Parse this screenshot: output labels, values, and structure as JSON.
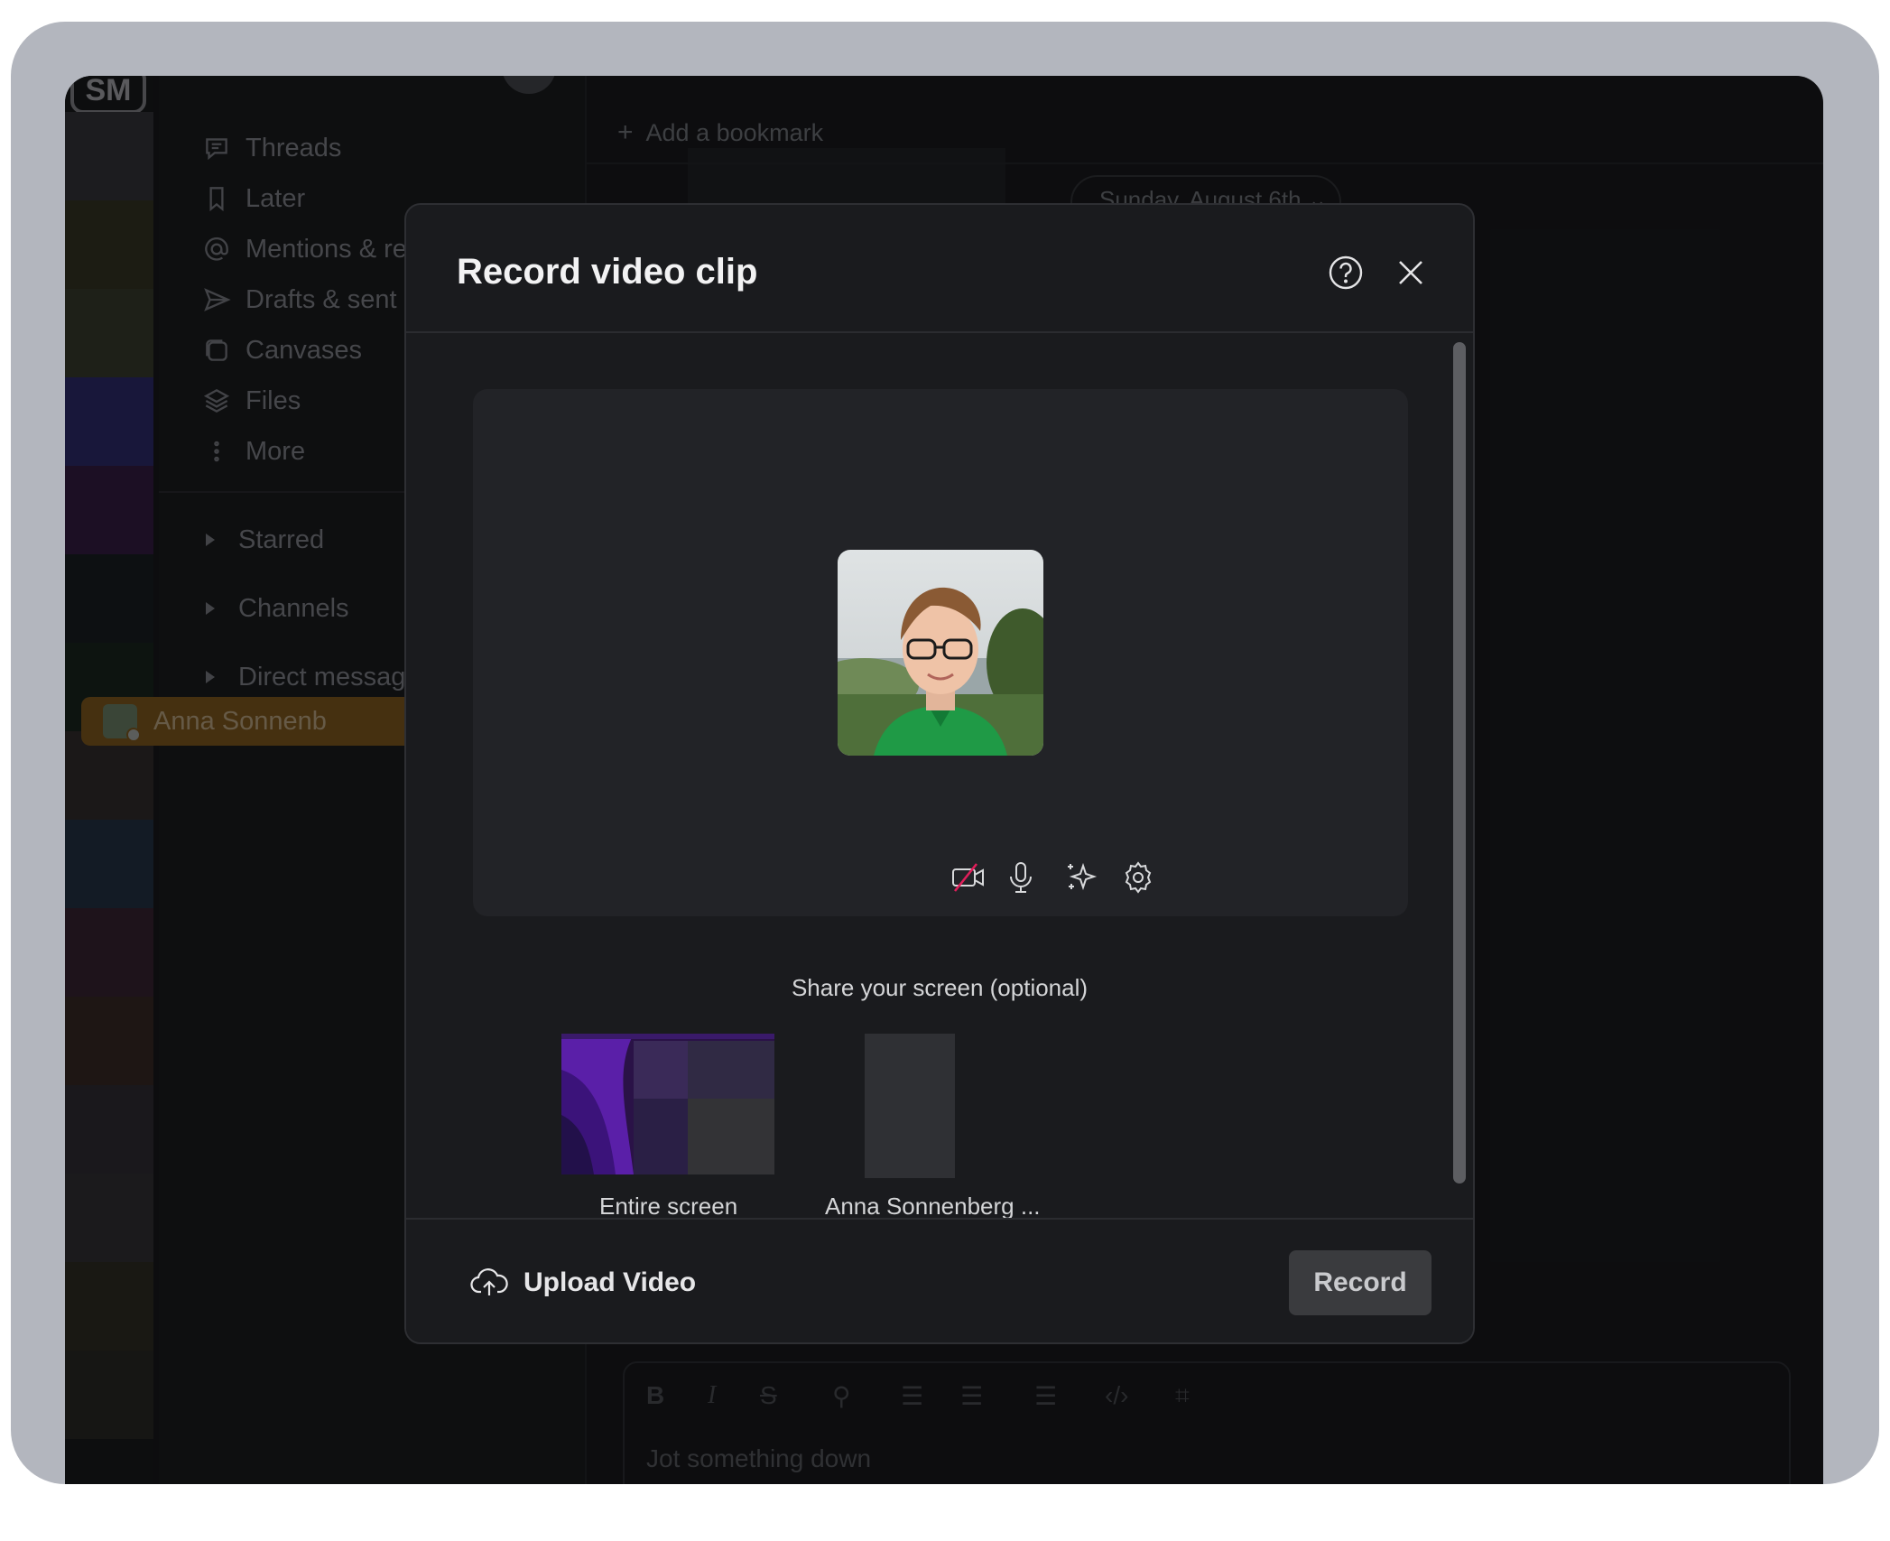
{
  "workspace": {
    "badge": "SM"
  },
  "sidebar": {
    "items": [
      {
        "label": "Threads",
        "icon": "threads-icon"
      },
      {
        "label": "Later",
        "icon": "bookmark-icon"
      },
      {
        "label": "Mentions & re",
        "icon": "at-icon"
      },
      {
        "label": "Drafts & sent",
        "icon": "send-icon"
      },
      {
        "label": "Canvases",
        "icon": "canvas-icon"
      },
      {
        "label": "Files",
        "icon": "layers-icon"
      },
      {
        "label": "More",
        "icon": "more-vertical-icon"
      }
    ],
    "sections": [
      "Starred",
      "Channels",
      "Direct messag"
    ],
    "active_dm": "Anna Sonnenb"
  },
  "main": {
    "bookmark_label": "Add a bookmark",
    "date_divider": "Sunday, August 6th",
    "composer_placeholder": "Jot something down"
  },
  "modal": {
    "title": "Record video clip",
    "share_label": "Share your screen (optional)",
    "screen_options": [
      {
        "label": "Entire screen"
      },
      {
        "label": "Anna Sonnenberg ..."
      }
    ],
    "upload_label": "Upload Video",
    "record_label": "Record"
  },
  "colors": {
    "accent_dm": "#6b4b1a",
    "modal_bg": "#1a1b1e",
    "camera_off_slash": "#e01e5a"
  }
}
